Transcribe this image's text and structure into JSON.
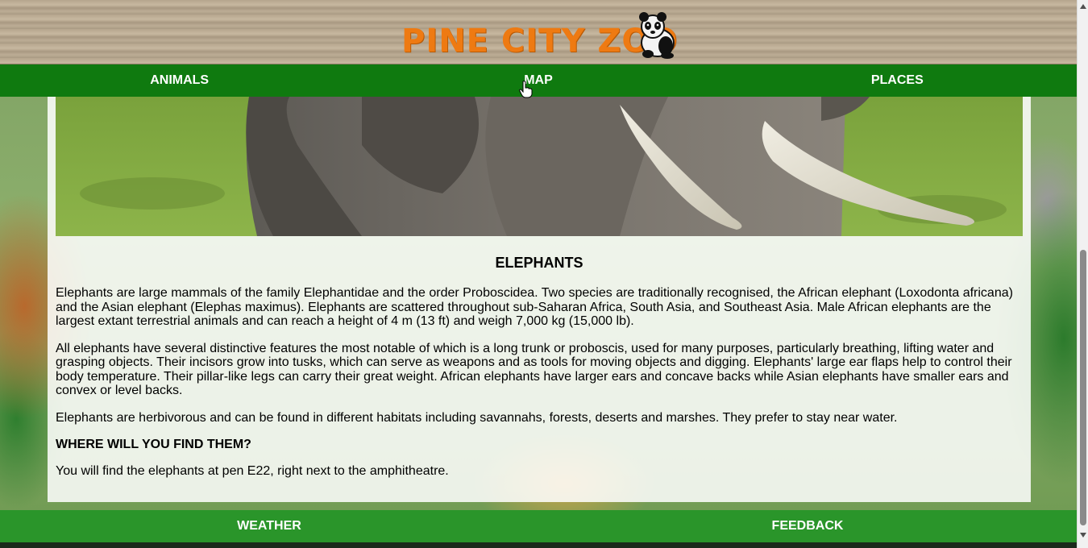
{
  "header": {
    "logo_text": "PINE CITY ZOO",
    "logo_icon": "panda-icon"
  },
  "top_nav": {
    "items": [
      {
        "label": "ANIMALS"
      },
      {
        "label": "MAP"
      },
      {
        "label": "PLACES"
      }
    ]
  },
  "hero": {
    "image": "elephant-tusks-photo"
  },
  "article": {
    "title": "ELEPHANTS",
    "paragraphs": [
      "Elephants are large mammals of the family Elephantidae and the order Proboscidea. Two species are traditionally recognised, the African elephant (Loxodonta africana) and the Asian elephant (Elephas maximus). Elephants are scattered throughout sub-Saharan Africa, South Asia, and Southeast Asia. Male African elephants are the largest extant terrestrial animals and can reach a height of 4 m (13 ft) and weigh 7,000 kg (15,000 lb).",
      "All elephants have several distinctive features the most notable of which is a long trunk or proboscis, used for many purposes, particularly breathing, lifting water and grasping objects. Their incisors grow into tusks, which can serve as weapons and as tools for moving objects and digging. Elephants' large ear flaps help to control their body temperature. Their pillar-like legs can carry their great weight. African elephants have larger ears and concave backs while Asian elephants have smaller ears and convex or level backs.",
      "Elephants are herbivorous and can be found in different habitats including savannahs, forests, deserts and marshes. They prefer to stay near water."
    ],
    "location_heading": "WHERE WILL YOU FIND THEM?",
    "location_text": "You will find the elephants at pen E22, right next to the amphitheatre."
  },
  "bottom_nav": {
    "items": [
      {
        "label": "WEATHER"
      },
      {
        "label": "FEEDBACK"
      }
    ]
  },
  "colors": {
    "top_nav_bg": "#0f7a0f",
    "bottom_nav_bg": "#2a952a",
    "logo_orange": "#ee7a12"
  }
}
